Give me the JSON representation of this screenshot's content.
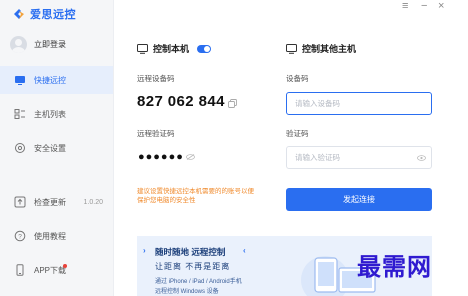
{
  "app": {
    "brand": "爱思远控"
  },
  "window_controls": {
    "menu": "≡",
    "minimize": "−",
    "close": "×"
  },
  "sidebar": {
    "login_label": "立即登录",
    "items": [
      {
        "label": "快捷远控",
        "icon": "monitor-icon"
      },
      {
        "label": "主机列表",
        "icon": "list-icon"
      },
      {
        "label": "安全设置",
        "icon": "shield-settings-icon"
      },
      {
        "label": "检查更新",
        "icon": "upload-icon",
        "version": "1.0.20"
      },
      {
        "label": "使用教程",
        "icon": "help-icon"
      },
      {
        "label": "APP下载",
        "icon": "phone-icon"
      }
    ]
  },
  "control_local": {
    "title": "控制本机",
    "toggle_on": true,
    "device_code_label": "远程设备码",
    "device_code": "827 062 844",
    "verify_label": "远程验证码",
    "password_mask": "●●●●●●",
    "hint": "建议设置快捷远控本机需要的的账号以便保护您电脑的安全性"
  },
  "control_other": {
    "title": "控制其他主机",
    "device_label": "设备码",
    "device_placeholder": "请输入设备码",
    "verify_label": "验证码",
    "verify_placeholder": "请输入验证码",
    "connect_label": "发起连接"
  },
  "banner": {
    "title": "随时随地 远程控制",
    "subtitle": "让距离 不再是距离",
    "line1": "通过 iPhone / iPad / Android手机",
    "line2": "远程控制 Windows 设备"
  },
  "watermark": "最需网",
  "colors": {
    "accent": "#2a6ef0",
    "hint": "#f08a2c",
    "sidebar_bg": "#f5f6f8"
  }
}
